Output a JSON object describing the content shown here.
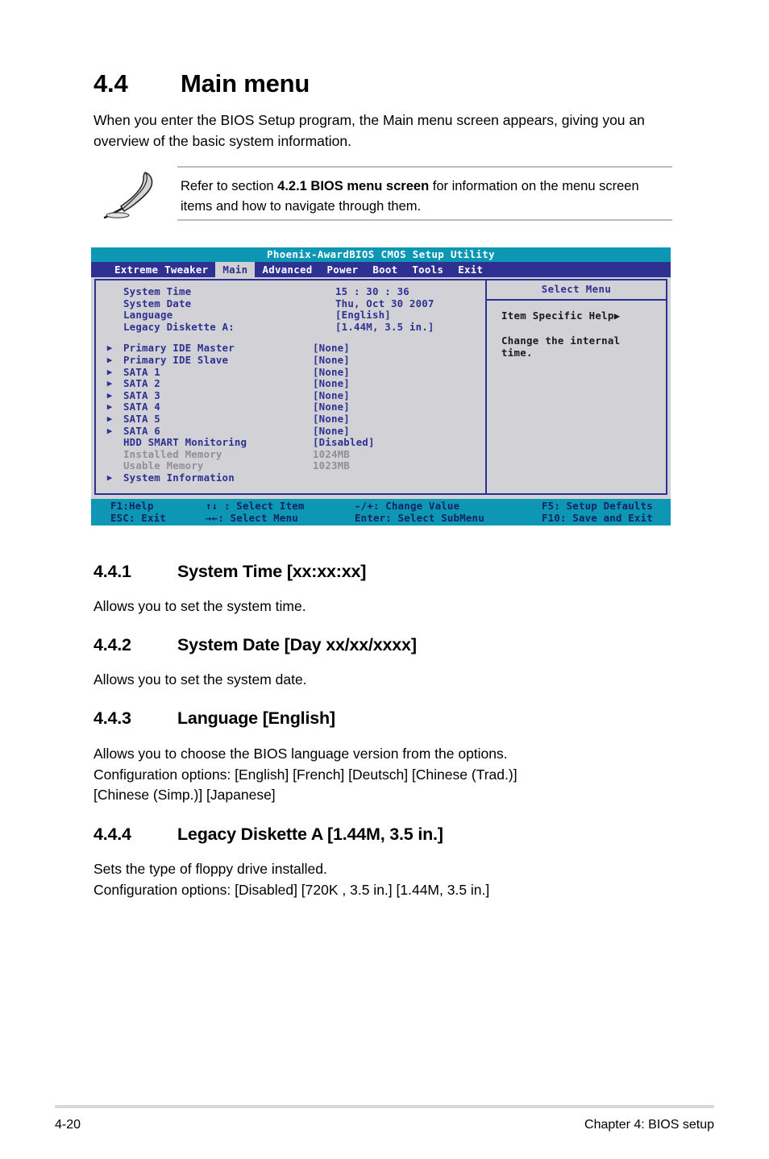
{
  "document": {
    "section_heading": {
      "number": "4.4",
      "title": "Main menu"
    },
    "intro": "When you enter the BIOS Setup program, the Main menu screen appears, giving you an overview of the basic system information.",
    "note": {
      "icon": "pencil-note-icon",
      "text_prefix": "Refer to section ",
      "text_bold": "4.2.1 BIOS menu screen",
      "text_suffix": " for information on the menu screen items and how to navigate through them."
    },
    "subsections": [
      {
        "number": "4.4.1",
        "title": "System Time [xx:xx:xx]",
        "body": "Allows you to set the system time."
      },
      {
        "number": "4.4.2",
        "title": "System Date [Day xx/xx/xxxx]",
        "body": "Allows you to set the system date."
      },
      {
        "number": "4.4.3",
        "title": "Language [English]",
        "body": "Allows you to choose the BIOS language version from the options.\nConfiguration options: [English] [French] [Deutsch] [Chinese (Trad.)]\n[Chinese (Simp.)] [Japanese]"
      },
      {
        "number": "4.4.4",
        "title": "Legacy Diskette A [1.44M, 3.5 in.]",
        "body": "Sets the type of floppy drive installed.\nConfiguration options: [Disabled] [720K , 3.5 in.] [1.44M, 3.5 in.]"
      }
    ],
    "footer": {
      "page_number": "4-20",
      "chapter": "Chapter 4: BIOS setup"
    }
  },
  "bios": {
    "title": "Phoenix-AwardBIOS CMOS Setup Utility",
    "tabs": [
      {
        "label": "Extreme Tweaker",
        "active": false
      },
      {
        "label": "Main",
        "active": true
      },
      {
        "label": "Advanced",
        "active": false
      },
      {
        "label": "Power",
        "active": false
      },
      {
        "label": "Boot",
        "active": false
      },
      {
        "label": "Tools",
        "active": false
      },
      {
        "label": "Exit",
        "active": false
      }
    ],
    "items": [
      {
        "label": "System Time",
        "value": "15 : 30 : 36",
        "submenu": false,
        "dim": false
      },
      {
        "label": "System Date",
        "value": "Thu, Oct 30 2007",
        "submenu": false,
        "dim": false
      },
      {
        "label": "Language",
        "value": "[English]",
        "submenu": false,
        "dim": false
      },
      {
        "label": "Legacy Diskette A:",
        "value": "[1.44M, 3.5 in.]",
        "submenu": false,
        "dim": false
      }
    ],
    "items2": [
      {
        "label": "Primary IDE Master",
        "value": "[None]",
        "submenu": true,
        "dim": false
      },
      {
        "label": "Primary IDE Slave",
        "value": "[None]",
        "submenu": true,
        "dim": false
      },
      {
        "label": "SATA 1",
        "value": "[None]",
        "submenu": true,
        "dim": false
      },
      {
        "label": "SATA 2",
        "value": "[None]",
        "submenu": true,
        "dim": false
      },
      {
        "label": "SATA 3",
        "value": "[None]",
        "submenu": true,
        "dim": false
      },
      {
        "label": "SATA 4",
        "value": "[None]",
        "submenu": true,
        "dim": false
      },
      {
        "label": "SATA 5",
        "value": "[None]",
        "submenu": true,
        "dim": false
      },
      {
        "label": "SATA 6",
        "value": "[None]",
        "submenu": true,
        "dim": false
      },
      {
        "label": "HDD SMART Monitoring",
        "value": "[Disabled]",
        "submenu": false,
        "dim": false
      },
      {
        "label": "Installed Memory",
        "value": "1024MB",
        "submenu": false,
        "dim": true
      },
      {
        "label": "Usable Memory",
        "value": "1023MB",
        "submenu": false,
        "dim": true
      },
      {
        "label": "System Information",
        "value": "",
        "submenu": true,
        "dim": false
      }
    ],
    "help_panel": {
      "header": "Select Menu",
      "title": "Item Specific Help",
      "title_arrow": "▶",
      "text": "Change the internal\ntime."
    },
    "legend": [
      {
        "c1": "F1:Help",
        "c2": "↑↓ : Select Item",
        "c3": "-/+: Change Value",
        "c4": "F5: Setup Defaults"
      },
      {
        "c1": "ESC: Exit",
        "c2": "→←: Select Menu",
        "c3": "Enter: Select SubMenu",
        "c4": "F10: Save and Exit"
      }
    ],
    "colors": {
      "title_bar": "#0d97b5",
      "tab_bar": "#2e3192",
      "panel_bg": "#d2d2d6",
      "accent_text": "#2e3192",
      "dim_text": "#8f8f95"
    },
    "bullet_glyph": "▶"
  }
}
